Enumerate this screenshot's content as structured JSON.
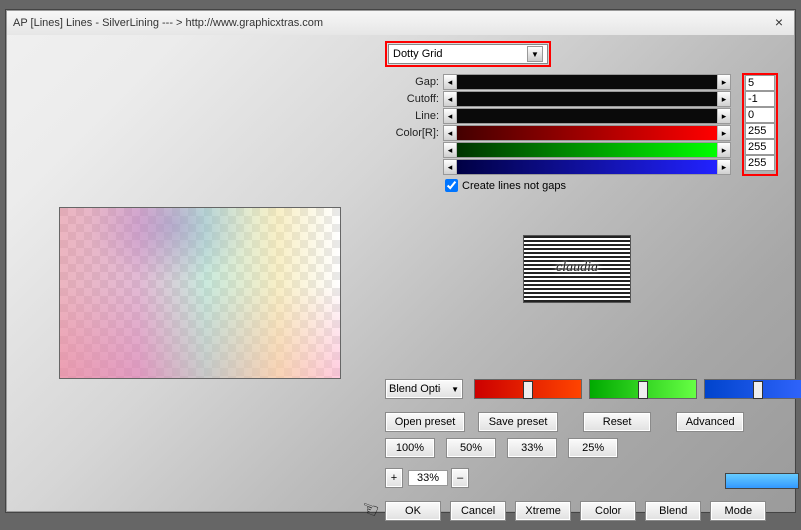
{
  "window": {
    "title": "AP [Lines]  Lines - SilverLining    --- > http://www.graphicxtras.com",
    "close": "×"
  },
  "preset": {
    "selected": "Dotty Grid"
  },
  "sliders": {
    "gap": {
      "label": "Gap:",
      "value": "5"
    },
    "cutoff": {
      "label": "Cutoff:",
      "value": "-1"
    },
    "line": {
      "label": "Line:",
      "value": "0"
    },
    "colorR": {
      "label": "Color[R]:",
      "value": "255"
    },
    "colorG": {
      "label": "",
      "value": "255"
    },
    "colorB": {
      "label": "",
      "value": "255"
    }
  },
  "checkbox": {
    "create_lines": "Create lines not gaps",
    "checked": true
  },
  "stamp": "claudia",
  "blend_options": "Blend Options",
  "buttons": {
    "open_preset": "Open preset",
    "save_preset": "Save preset",
    "reset": "Reset",
    "advanced": "Advanced"
  },
  "percent_buttons": {
    "p100": "100%",
    "p50": "50%",
    "p33": "33%",
    "p25": "25%"
  },
  "zoom": {
    "plus": "+",
    "value": "33%",
    "minus": "–"
  },
  "bottom": {
    "ok": "OK",
    "cancel": "Cancel",
    "xtreme": "Xtreme",
    "color": "Color",
    "blend": "Blend",
    "mode": "Mode"
  },
  "finger": {
    "glyph": "☞"
  },
  "colors": {
    "hl": "#ff0000",
    "swatch": "#3399ff"
  }
}
